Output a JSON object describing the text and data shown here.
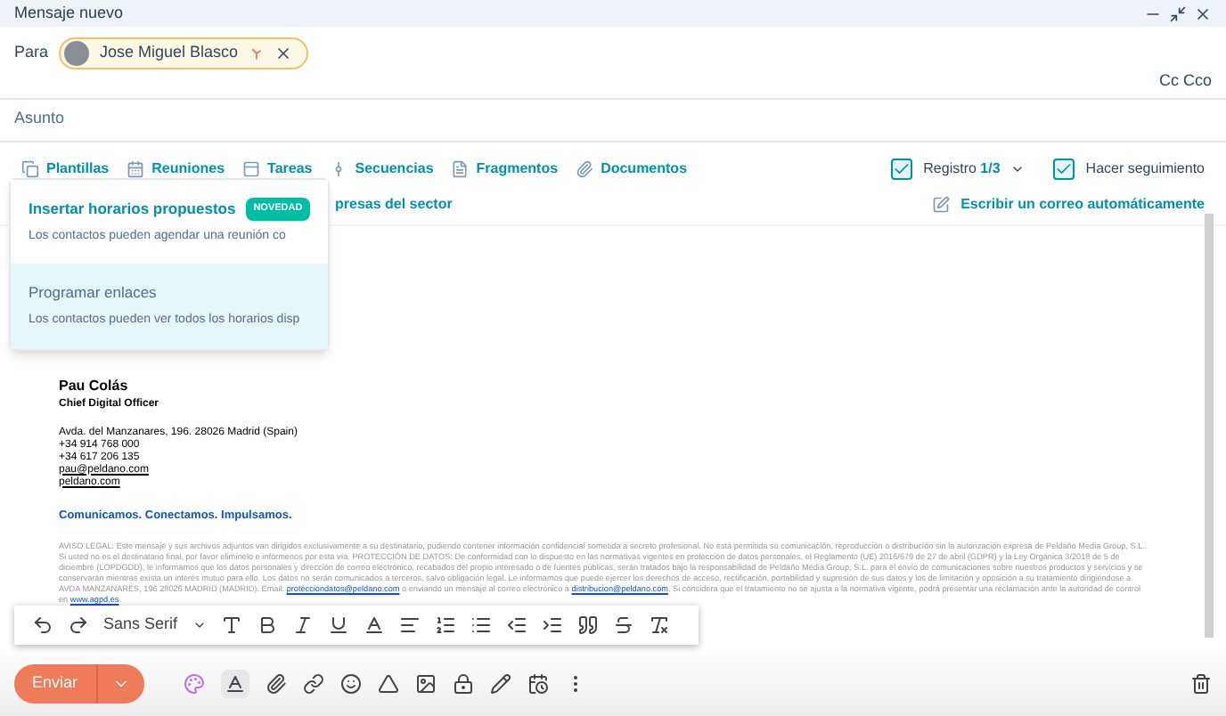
{
  "window": {
    "title": "Mensaje nuevo"
  },
  "to": {
    "label": "Para",
    "recipient": "Jose Miguel Blasco",
    "cc": "Cc Cco"
  },
  "subject": {
    "placeholder": "Asunto"
  },
  "tools": [
    {
      "label": "Plantillas",
      "kind": "copy"
    },
    {
      "label": "Reuniones",
      "kind": "calendar"
    },
    {
      "label": "Tareas",
      "kind": "task"
    },
    {
      "label": "Secuencias",
      "kind": "sequence"
    },
    {
      "label": "Fragmentos",
      "kind": "snippet"
    },
    {
      "label": "Documentos",
      "kind": "clip"
    }
  ],
  "options": [
    {
      "label": "Registro",
      "value": "1/3",
      "checked": true
    },
    {
      "label": "Hacer seguimiento",
      "checked": true
    }
  ],
  "suggestion": "presas del sector",
  "auto_write": "Escribir un correo automáticamente",
  "menu": [
    {
      "title": "Insertar horarios propuestos",
      "badge": "NOVEDAD",
      "description": "Los contactos pueden agendar una reunión co",
      "selected": false
    },
    {
      "title": "Programar enlaces",
      "description": "Los contactos pueden ver todos los horarios disp",
      "selected": true
    }
  ],
  "signature": {
    "name": "Pau Colás",
    "role": "Chief Digital Officer",
    "lines": [
      "Avda. del Manzanares, 196. 28026 Madrid (Spain)",
      "+34 914 768 000",
      "+34 617 206 135"
    ],
    "links": [
      "pau@peldano.com",
      "peldano.com"
    ],
    "slogan": "Comunicamos. Conectamos. Impulsamos.",
    "legal": [
      {
        "kind": "text",
        "text": "AVISO LEGAL: Este mensaje y sus archivos adjuntos van dirigidos exclusivamente a su destinatario, pudiendo contener información confidencial sometida a secreto profesional. No está permitida su comunicación, reproducción o distribución sin la autorización expresa de Peldaño Media Group, S.L.. Si usted no es el destinatario final, por favor elimínelo e infórmenos por esta vía. PROTECCIÓN DE DATOS: De conformidad con lo dispuesto en las normativas vigentes en protección de datos personales, el Reglamento (UE) 2016/679 de 27 de abril (GDPR) y la Ley Orgánica 3/2018 de 5 de diciembre (LOPDGDD), le informamos que los datos personales y dirección de correo electrónico, recabados del propio interesado o de fuentes públicas, serán tratados bajo la responsabilidad de Peldaño Media Group, S.L. para el envío de comunicaciones sobre nuestros productos y servicios y se conservarán mientras exista un interés mutuo para ello. Los datos no serán comunicados a terceros, salvo obligación legal. Le informamos que puede ejercer los derechos de acceso, rectificación, portabilidad y supresión de sus datos y los de limitación y oposición a su tratamiento dirigiéndose a AVDA MANZANARES, 196 28026 MADRID (MADRID). Email:"
      },
      {
        "kind": "link",
        "text": "protecciondatos@peldano.com"
      },
      {
        "kind": "text",
        "text": "o enviando un mensaje al correo electrónico a"
      },
      {
        "kind": "link",
        "text": "distribucion@peldano.com"
      },
      {
        "kind": "text",
        "text": ". Si considera que el tratamiento no se ajusta a la normativa vigente, podrá presentar una reclamación ante la autoridad de control en"
      },
      {
        "kind": "link",
        "text": "www.agpd.es"
      }
    ]
  },
  "format": {
    "font": "Sans Serif"
  },
  "send": "Enviar"
}
